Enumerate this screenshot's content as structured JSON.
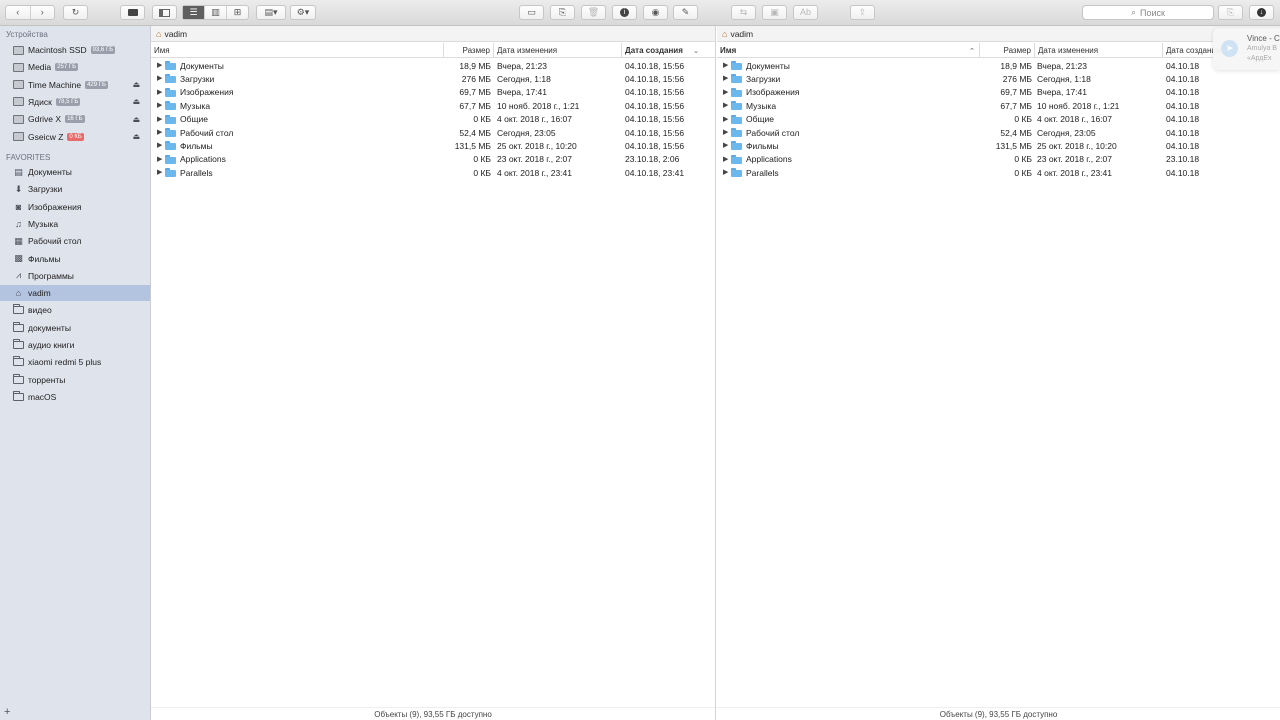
{
  "toolbar": {
    "back": "‹",
    "forward": "›",
    "refresh": "↻",
    "terminal": "▭",
    "search_placeholder": "Поиск"
  },
  "sidebar": {
    "devices_header": "Устройства",
    "devices": [
      {
        "label": "Macintosh SSD",
        "badge": "93,6 ГБ",
        "eject": false,
        "badge_color": "gray"
      },
      {
        "label": "Media",
        "badge": "257 ГБ",
        "eject": false,
        "badge_color": "gray"
      },
      {
        "label": "Time Machine",
        "badge": "429 ГБ",
        "eject": true,
        "badge_color": "gray"
      },
      {
        "label": "Ядиск",
        "badge": "78,5 ГБ",
        "eject": true,
        "badge_color": "gray"
      },
      {
        "label": "Gdrive X",
        "badge": "16 ГБ",
        "eject": true,
        "badge_color": "gray"
      },
      {
        "label": "Gseicw Z",
        "badge": "0 КБ",
        "eject": true,
        "badge_color": "red"
      }
    ],
    "favorites_header": "FAVORITES",
    "favorites": [
      {
        "label": "Документы",
        "icon": "document-icon"
      },
      {
        "label": "Загрузки",
        "icon": "download-icon"
      },
      {
        "label": "Изображения",
        "icon": "camera-icon"
      },
      {
        "label": "Музыка",
        "icon": "music-icon"
      },
      {
        "label": "Рабочий стол",
        "icon": "desktop-icon"
      },
      {
        "label": "Фильмы",
        "icon": "film-icon"
      },
      {
        "label": "Программы",
        "icon": "apps-icon"
      },
      {
        "label": "vadim",
        "icon": "home-icon",
        "selected": true
      },
      {
        "label": "видео",
        "icon": "folder-icon"
      },
      {
        "label": "документы",
        "icon": "folder-icon"
      },
      {
        "label": "аудио книги",
        "icon": "folder-icon"
      },
      {
        "label": "xiaomi redmi 5 plus",
        "icon": "folder-icon"
      },
      {
        "label": "торренты",
        "icon": "folder-icon"
      },
      {
        "label": "macOS",
        "icon": "folder-icon"
      }
    ],
    "add": "+"
  },
  "left_panel": {
    "path": "vadim",
    "columns": {
      "name": "Имя",
      "size": "Размер",
      "modified": "Дата изменения",
      "created": "Дата создания"
    },
    "rows": [
      {
        "name": "Документы",
        "size": "18,9 МБ",
        "modified": "Вчера, 21:23",
        "created": "04.10.18, 15:56"
      },
      {
        "name": "Загрузки",
        "size": "276 МБ",
        "modified": "Сегодня, 1:18",
        "created": "04.10.18, 15:56"
      },
      {
        "name": "Изображения",
        "size": "69,7 МБ",
        "modified": "Вчера, 17:41",
        "created": "04.10.18, 15:56"
      },
      {
        "name": "Музыка",
        "size": "67,7 МБ",
        "modified": "10 нояб. 2018 г., 1:21",
        "created": "04.10.18, 15:56"
      },
      {
        "name": "Общие",
        "size": "0 КБ",
        "modified": "4 окт. 2018 г., 16:07",
        "created": "04.10.18, 15:56"
      },
      {
        "name": "Рабочий стол",
        "size": "52,4 МБ",
        "modified": "Сегодня, 23:05",
        "created": "04.10.18, 15:56"
      },
      {
        "name": "Фильмы",
        "size": "131,5 МБ",
        "modified": "25 окт. 2018 г., 10:20",
        "created": "04.10.18, 15:56"
      },
      {
        "name": "Applications",
        "size": "0 КБ",
        "modified": "23 окт. 2018 г., 2:07",
        "created": "23.10.18, 2:06"
      },
      {
        "name": "Parallels",
        "size": "0 КБ",
        "modified": "4 окт. 2018 г., 23:41",
        "created": "04.10.18, 23:41"
      }
    ],
    "status": "Объекты (9), 93,55 ГБ доступно"
  },
  "right_panel": {
    "path": "vadim",
    "columns": {
      "name": "Имя",
      "size": "Размер",
      "modified": "Дата изменения",
      "created": "Дата создания"
    },
    "rows": [
      {
        "name": "Документы",
        "size": "18,9 МБ",
        "modified": "Вчера, 21:23",
        "created": "04.10.18"
      },
      {
        "name": "Загрузки",
        "size": "276 МБ",
        "modified": "Сегодня, 1:18",
        "created": "04.10.18"
      },
      {
        "name": "Изображения",
        "size": "69,7 МБ",
        "modified": "Вчера, 17:41",
        "created": "04.10.18"
      },
      {
        "name": "Музыка",
        "size": "67,7 МБ",
        "modified": "10 нояб. 2018 г., 1:21",
        "created": "04.10.18"
      },
      {
        "name": "Общие",
        "size": "0 КБ",
        "modified": "4 окт. 2018 г., 16:07",
        "created": "04.10.18"
      },
      {
        "name": "Рабочий стол",
        "size": "52,4 МБ",
        "modified": "Сегодня, 23:05",
        "created": "04.10.18"
      },
      {
        "name": "Фильмы",
        "size": "131,5 МБ",
        "modified": "25 окт. 2018 г., 10:20",
        "created": "04.10.18"
      },
      {
        "name": "Applications",
        "size": "0 КБ",
        "modified": "23 окт. 2018 г., 2:07",
        "created": "23.10.18"
      },
      {
        "name": "Parallels",
        "size": "0 КБ",
        "modified": "4 окт. 2018 г., 23:41",
        "created": "04.10.18"
      }
    ],
    "status": "Объекты (9), 93,55 ГБ доступно"
  },
  "notification": {
    "title": "Vince - C",
    "line1": "Amulya B",
    "line2": "«АрдЕх"
  }
}
